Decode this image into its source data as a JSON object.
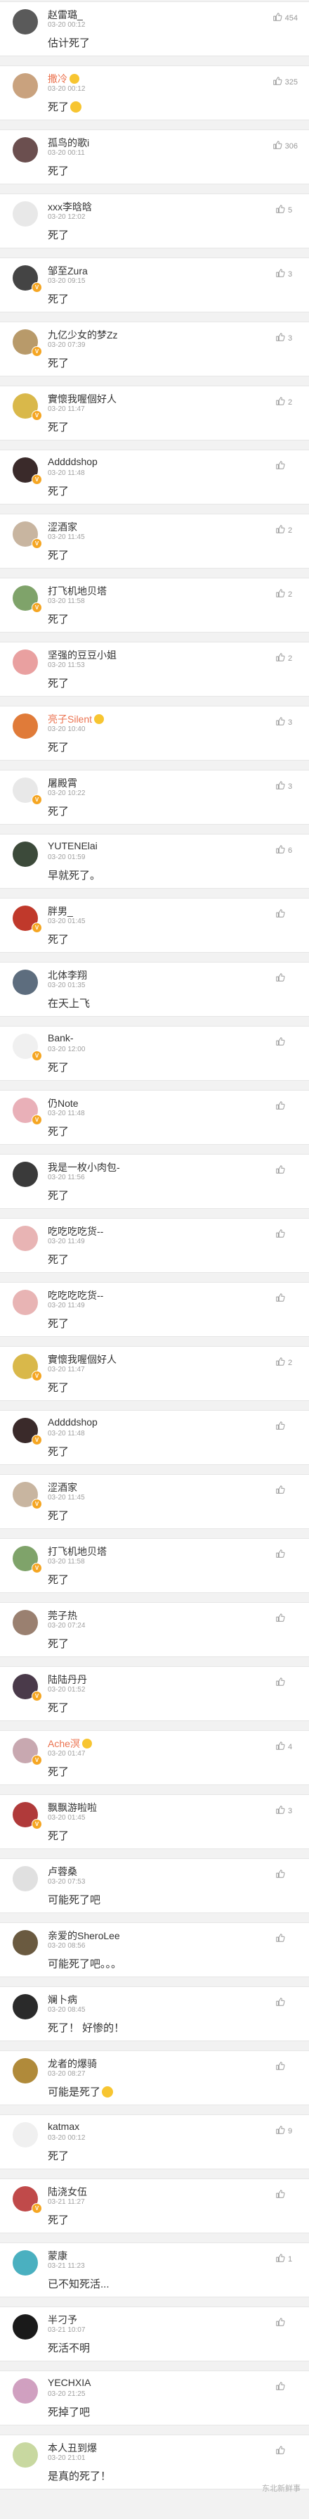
{
  "colors": {
    "name_orange": "#eb7350",
    "badge": "#f5a623",
    "time": "#a0a0a0"
  },
  "icons": {
    "like": "thumbs-up-icon",
    "verified": "v-badge-icon"
  },
  "watermark": "东北新鲜事",
  "comments": [
    {
      "name": "赵雷璐_",
      "time": "03-20 00:12",
      "text": "估计死了",
      "likes": "454",
      "orange": false,
      "emoji": false,
      "text_emoji": false,
      "badge": false,
      "avatar": "#5a5a5a"
    },
    {
      "name": "撒冷",
      "time": "03-20 00:12",
      "text": "死了",
      "likes": "325",
      "orange": true,
      "emoji": true,
      "text_emoji": true,
      "badge": false,
      "avatar": "#c9a27e"
    },
    {
      "name": "孤鸟的歌i",
      "time": "03-20 00:11",
      "text": "死了",
      "likes": "306",
      "orange": false,
      "emoji": false,
      "text_emoji": false,
      "badge": false,
      "avatar": "#6b4f4f"
    },
    {
      "name": "xxx李晗晗",
      "time": "03-20 12:02",
      "text": "死了",
      "likes": "5",
      "orange": false,
      "emoji": false,
      "text_emoji": false,
      "badge": false,
      "avatar": "#e8e8e8"
    },
    {
      "name": "邹至Zura",
      "time": "03-20 09:15",
      "text": "死了",
      "likes": "3",
      "orange": false,
      "emoji": false,
      "text_emoji": false,
      "badge": true,
      "avatar": "#444444"
    },
    {
      "name": "九亿少女的梦Zz",
      "time": "03-20 07:39",
      "text": "死了",
      "likes": "3",
      "orange": false,
      "emoji": false,
      "text_emoji": false,
      "badge": true,
      "avatar": "#b89a6a"
    },
    {
      "name": "實懷我喔個好人",
      "time": "03-20 11:47",
      "text": "死了",
      "likes": "2",
      "orange": false,
      "emoji": false,
      "text_emoji": false,
      "badge": true,
      "avatar": "#d9b84a"
    },
    {
      "name": "Addddshop",
      "time": "03-20 11:48",
      "text": "死了",
      "likes": "",
      "orange": false,
      "emoji": false,
      "text_emoji": false,
      "badge": true,
      "avatar": "#3a2a2a"
    },
    {
      "name": "涩酒家",
      "time": "03-20 11:45",
      "text": "死了",
      "likes": "2",
      "orange": false,
      "emoji": false,
      "text_emoji": false,
      "badge": true,
      "avatar": "#c8b5a0"
    },
    {
      "name": "打飞机地贝塔",
      "time": "03-20 11:58",
      "text": "死了",
      "likes": "2",
      "orange": false,
      "emoji": false,
      "text_emoji": false,
      "badge": true,
      "avatar": "#7fa36a"
    },
    {
      "name": "坚强的豆豆小姐",
      "time": "03-20 11:53",
      "text": "死了",
      "likes": "2",
      "orange": false,
      "emoji": false,
      "text_emoji": false,
      "badge": false,
      "avatar": "#e9a0a0"
    },
    {
      "name": "亮子Silent",
      "time": "03-20 10:40",
      "text": "死了",
      "likes": "3",
      "orange": true,
      "emoji": true,
      "text_emoji": false,
      "badge": false,
      "avatar": "#e07b39"
    },
    {
      "name": "屠殿霄",
      "time": "03-20 10:22",
      "text": "死了",
      "likes": "3",
      "orange": false,
      "emoji": false,
      "text_emoji": false,
      "badge": true,
      "avatar": "#e8e8e8"
    },
    {
      "name": "YUTENElai",
      "time": "03-20 01:59",
      "text": "早就死了。",
      "likes": "6",
      "orange": false,
      "emoji": false,
      "text_emoji": false,
      "badge": false,
      "avatar": "#3c4a3a"
    },
    {
      "name": "胖男_",
      "time": "03-20 01:45",
      "text": "死了",
      "likes": "",
      "orange": false,
      "emoji": false,
      "text_emoji": false,
      "badge": true,
      "avatar": "#c0392b"
    },
    {
      "name": "北体李翔",
      "time": "03-20 01:35",
      "text": "在天上飞",
      "likes": "",
      "orange": false,
      "emoji": false,
      "text_emoji": false,
      "badge": false,
      "avatar": "#5d6d7e"
    },
    {
      "name": "Bank-",
      "time": "03-20 12:00",
      "text": "死了",
      "likes": "",
      "orange": false,
      "emoji": false,
      "text_emoji": false,
      "badge": true,
      "avatar": "#f0f0f0"
    },
    {
      "name": "仍Note",
      "time": "03-20 11:48",
      "text": "死了",
      "likes": "",
      "orange": false,
      "emoji": false,
      "text_emoji": false,
      "badge": true,
      "avatar": "#e9b0b8"
    },
    {
      "name": "我是一枚小肉包-",
      "time": "03-20 11:56",
      "text": "死了",
      "likes": "",
      "orange": false,
      "emoji": false,
      "text_emoji": false,
      "badge": false,
      "avatar": "#3a3a3a"
    },
    {
      "name": "吃吃吃吃货--",
      "time": "03-20 11:49",
      "text": "死了",
      "likes": "",
      "orange": false,
      "emoji": false,
      "text_emoji": false,
      "badge": false,
      "avatar": "#e8b4b4"
    },
    {
      "name": "吃吃吃吃货--",
      "time": "03-20 11:49",
      "text": "死了",
      "likes": "",
      "orange": false,
      "emoji": false,
      "text_emoji": false,
      "badge": false,
      "avatar": "#e8b4b4"
    },
    {
      "name": "實懷我喔個好人",
      "time": "03-20 11:47",
      "text": "死了",
      "likes": "2",
      "orange": false,
      "emoji": false,
      "text_emoji": false,
      "badge": true,
      "avatar": "#d9b84a"
    },
    {
      "name": "Addddshop",
      "time": "03-20 11:48",
      "text": "死了",
      "likes": "",
      "orange": false,
      "emoji": false,
      "text_emoji": false,
      "badge": true,
      "avatar": "#3a2a2a"
    },
    {
      "name": "涩酒家",
      "time": "03-20 11:45",
      "text": "死了",
      "likes": "",
      "orange": false,
      "emoji": false,
      "text_emoji": false,
      "badge": true,
      "avatar": "#c8b5a0"
    },
    {
      "name": "打飞机地贝塔",
      "time": "03-20 11:58",
      "text": "死了",
      "likes": "",
      "orange": false,
      "emoji": false,
      "text_emoji": false,
      "badge": true,
      "avatar": "#7fa36a"
    },
    {
      "name": "莞子热",
      "time": "03-20 07:24",
      "text": "死了",
      "likes": "",
      "orange": false,
      "emoji": false,
      "text_emoji": false,
      "badge": false,
      "avatar": "#9a8070"
    },
    {
      "name": "陆陆丹丹",
      "time": "03-20 01:52",
      "text": "死了",
      "likes": "",
      "orange": false,
      "emoji": false,
      "text_emoji": false,
      "badge": true,
      "avatar": "#4a3a4a"
    },
    {
      "name": "Ache溟",
      "time": "03-20 01:47",
      "text": "死了",
      "likes": "4",
      "orange": true,
      "emoji": true,
      "text_emoji": false,
      "badge": true,
      "avatar": "#c8a8b0"
    },
    {
      "name": "飘飘游啦啦",
      "time": "03-20 01:45",
      "text": "死了",
      "likes": "3",
      "orange": false,
      "emoji": false,
      "text_emoji": false,
      "badge": true,
      "avatar": "#b03a3a"
    },
    {
      "name": "卢蓉桑",
      "time": "03-20 07:53",
      "text": "可能死了吧",
      "likes": "",
      "orange": false,
      "emoji": false,
      "text_emoji": false,
      "badge": false,
      "avatar": "#e0e0e0"
    },
    {
      "name": "亲爱的SheroLee",
      "time": "03-20 08:56",
      "text": "可能死了吧。。。",
      "likes": "",
      "orange": false,
      "emoji": false,
      "text_emoji": false,
      "badge": false,
      "avatar": "#6a5a40"
    },
    {
      "name": "斓卜病",
      "time": "03-20 08:45",
      "text": "死了！ 好惨的！",
      "likes": "",
      "orange": false,
      "emoji": false,
      "text_emoji": false,
      "badge": false,
      "avatar": "#2a2a2a"
    },
    {
      "name": "龙者的爆骑",
      "time": "03-20 08:27",
      "text": "可能是死了",
      "likes": "",
      "orange": false,
      "emoji": false,
      "text_emoji": true,
      "badge": false,
      "avatar": "#b08a3a"
    },
    {
      "name": "katmax",
      "time": "03-20 00:12",
      "text": "死了",
      "likes": "9",
      "orange": false,
      "emoji": false,
      "text_emoji": false,
      "badge": false,
      "avatar": "#f0f0f0"
    },
    {
      "name": "陆浇女伍",
      "time": "03-21 11:27",
      "text": "死了",
      "likes": "",
      "orange": false,
      "emoji": false,
      "text_emoji": false,
      "badge": true,
      "avatar": "#c04a4a"
    },
    {
      "name": "蒙康",
      "time": "03-21 11:23",
      "text": "已不知死活...",
      "likes": "1",
      "orange": false,
      "emoji": false,
      "text_emoji": false,
      "badge": false,
      "avatar": "#4ab0c0"
    },
    {
      "name": "半刁予",
      "time": "03-21 10:07",
      "text": "死活不明",
      "likes": "",
      "orange": false,
      "emoji": false,
      "text_emoji": false,
      "badge": false,
      "avatar": "#1a1a1a"
    },
    {
      "name": "YECHXIA",
      "time": "03-20 21:25",
      "text": "死掉了吧",
      "likes": "",
      "orange": false,
      "emoji": false,
      "text_emoji": false,
      "badge": false,
      "avatar": "#d0a0c0"
    },
    {
      "name": "本人丑到爆",
      "time": "03-20 21:01",
      "text": "是真的死了！",
      "likes": "",
      "orange": false,
      "emoji": false,
      "text_emoji": false,
      "badge": false,
      "avatar": "#c8d8a0"
    }
  ]
}
